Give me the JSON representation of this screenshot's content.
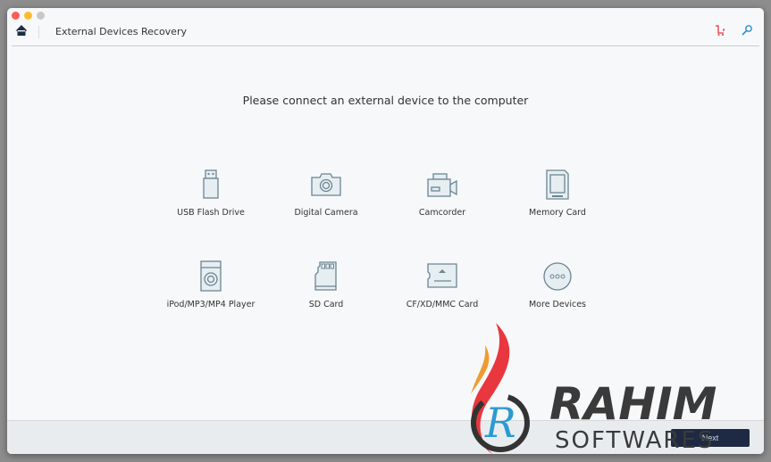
{
  "window": {
    "title": "External Devices Recovery"
  },
  "header": {
    "home_icon": "home-icon",
    "cart_icon": "cart-icon",
    "key_icon": "key-icon"
  },
  "prompt": "Please connect an external device to the computer",
  "devices": [
    {
      "label": "USB Flash Drive",
      "icon": "usb-drive-icon"
    },
    {
      "label": "Digital Camera",
      "icon": "camera-icon"
    },
    {
      "label": "Camcorder",
      "icon": "camcorder-icon"
    },
    {
      "label": "Memory Card",
      "icon": "memory-card-icon"
    },
    {
      "label": "iPod/MP3/MP4 Player",
      "icon": "mp3-player-icon"
    },
    {
      "label": "SD Card",
      "icon": "sd-card-icon"
    },
    {
      "label": "CF/XD/MMC Card",
      "icon": "cf-card-icon"
    },
    {
      "label": "More Devices",
      "icon": "more-icon"
    }
  ],
  "footer": {
    "next_label": "Next"
  },
  "watermark": {
    "line1": "RAHIM",
    "line2": "SOFTWARES"
  },
  "colors": {
    "icon": "#6b8592",
    "icon_fill": "#e6eef2",
    "accent_cart": "#e0393e",
    "accent_key": "#2a8fd0",
    "button": "#1e2a44"
  }
}
